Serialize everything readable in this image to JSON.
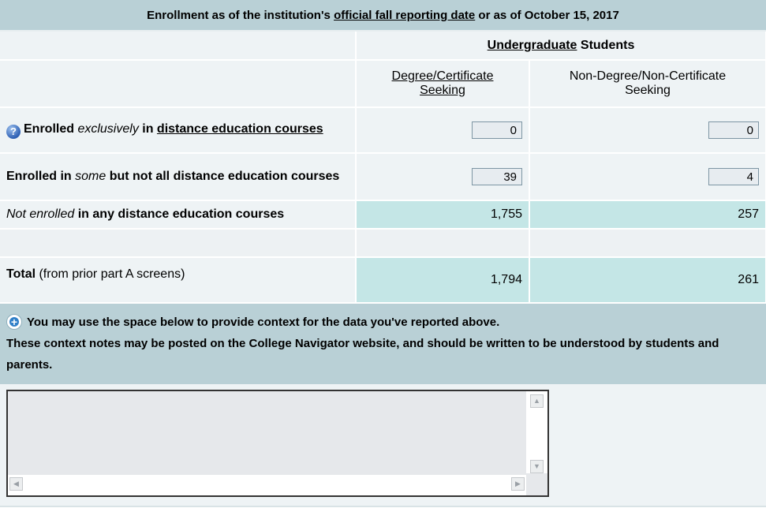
{
  "title": {
    "prefix": "Enrollment as of the institution's ",
    "link": "official fall reporting date",
    "suffix": " or as of October 15, 2017"
  },
  "group_header": {
    "link": "Undergraduate",
    "suffix": " Students"
  },
  "columns": {
    "degree": {
      "line1": "Degree/Certificate",
      "line2": "Seeking"
    },
    "non_degree": {
      "line1": "Non-Degree/Non-Certificate",
      "line2": "Seeking"
    }
  },
  "rows": {
    "exclusive": {
      "pre": "Enrolled ",
      "em": "exclusively",
      "mid": " in ",
      "link": "distance education courses",
      "icon": "help-icon",
      "degree_value": "0",
      "non_degree_value": "0"
    },
    "some": {
      "pre": "Enrolled in ",
      "em": "some",
      "post": " but not all distance education courses",
      "degree_value": "39",
      "non_degree_value": "4"
    },
    "not_enrolled": {
      "em": "Not enrolled",
      "post": " in any distance education courses",
      "degree_value": "1,755",
      "non_degree_value": "257"
    },
    "total": {
      "bold": "Total",
      "post": " (from prior part A screens)",
      "degree_value": "1,794",
      "non_degree_value": "261"
    }
  },
  "context": {
    "icon": "add-context-icon",
    "line1": "You may use the space below to provide context for the data you've reported above.",
    "line2": "These context notes may be posted on the College Navigator website, and should be written to be understood by students and parents."
  },
  "notes": {
    "value": ""
  },
  "colors": {
    "header_bg": "#b9d0d6",
    "row_bg": "#eef3f5",
    "calc_bg": "#c4e6e6"
  }
}
